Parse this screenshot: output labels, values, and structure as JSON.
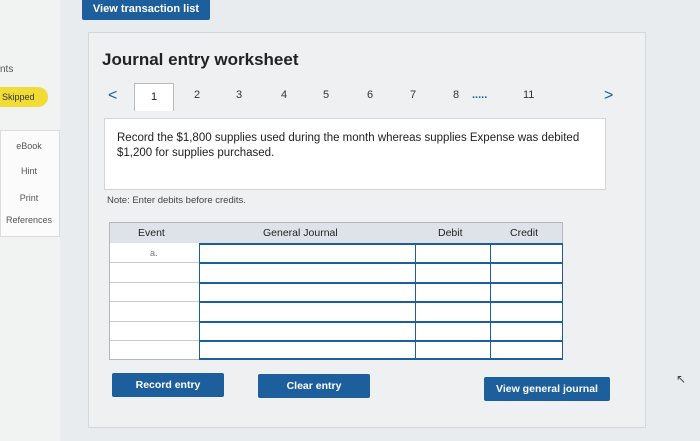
{
  "top_button": {
    "label": "View transaction list"
  },
  "sidebar": {
    "pts_label": "nts",
    "skipped_label": "Skipped",
    "items": [
      {
        "label": "eBook"
      },
      {
        "label": "Hint"
      },
      {
        "label": "Print"
      },
      {
        "label": "References"
      }
    ]
  },
  "worksheet": {
    "title": "Journal entry worksheet",
    "pager": {
      "prev_icon": "<",
      "next_icon": ">",
      "tabs": [
        "1",
        "2",
        "3",
        "4",
        "5",
        "6",
        "7",
        "8"
      ],
      "ellipsis": ".....",
      "last_tab": "11",
      "active": "1"
    },
    "prompt": "Record the $1,800 supplies used during the month whereas supplies Expense was debited $1,200 for supplies purchased.",
    "note": "Note: Enter debits before credits.",
    "table": {
      "headers": {
        "event": "Event",
        "general_journal": "General Journal",
        "debit": "Debit",
        "credit": "Credit"
      },
      "first_event": "a."
    },
    "buttons": {
      "record": "Record entry",
      "clear": "Clear entry",
      "view_general": "View general journal"
    }
  },
  "colors": {
    "accent": "#1d5f9c",
    "skipped": "#f1dc36"
  }
}
